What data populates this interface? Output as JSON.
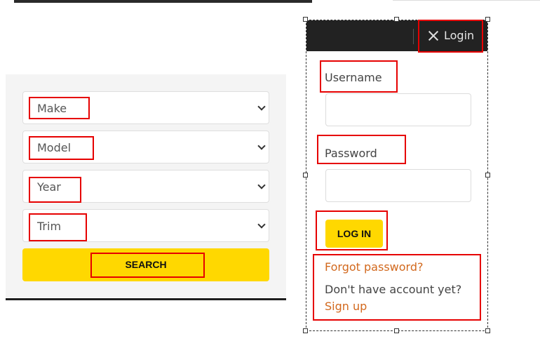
{
  "search": {
    "make": "Make",
    "model": "Model",
    "year": "Year",
    "trim": "Trim",
    "button_label": "SEARCH"
  },
  "login": {
    "header_label": "Login",
    "username_label": "Username",
    "username_value": "",
    "password_label": "Password",
    "password_value": "",
    "button_label": "LOG IN",
    "forgot_link": "Forgot password?",
    "no_account_text": "Don't have account yet?",
    "signup_link": "Sign up"
  },
  "icons": {
    "close": "close-icon",
    "dropdown": "chevron-down-icon"
  },
  "colors": {
    "accent_yellow": "#ffd800",
    "header_dark": "#222222",
    "link_orange": "#d2691e",
    "annotation_red": "#e60000"
  }
}
